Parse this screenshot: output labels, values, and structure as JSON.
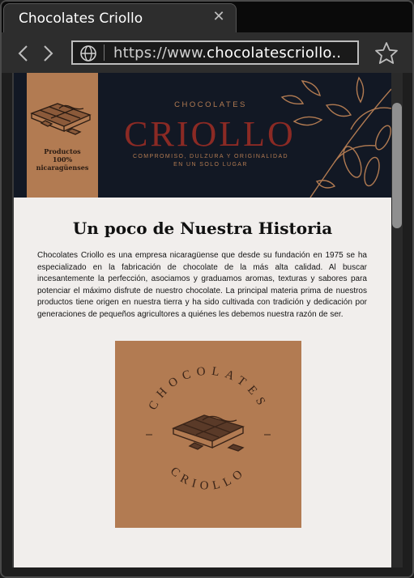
{
  "browser": {
    "tab_title": "Chocolates Criollo",
    "tab_close_icon": "close-icon",
    "url_scheme": "https://www.",
    "url_host": "chocolatescriollo..",
    "back_icon": "chevron-left-icon",
    "forward_icon": "chevron-right-icon",
    "site_icon": "globe-icon",
    "bookmark_icon": "star-icon"
  },
  "banner": {
    "left_label_line1": "Productos",
    "left_label_line2": "100% nicaragüenses",
    "small_heading": "CHOCOLATES",
    "brand_title": "CRIOLLO",
    "tagline_line1": "COMPROMISO, DULZURA Y ORIGINALIDAD",
    "tagline_line2": "EN UN SOLO LUGAR",
    "colors": {
      "background": "#121824",
      "accent": "#b27b52",
      "title": "#8b2a24"
    }
  },
  "story": {
    "heading": "Un poco de Nuestra Historia",
    "body": "Chocolates Criollo es una empresa nicaragüense que desde su fundación en 1975 se ha especializado en la fabricación de chocolate de la más alta calidad. Al buscar incesantemente la perfección, asociamos y graduamos aromas, texturas y sabores para potenciar el máximo disfrute de nuestro chocolate. La principal materia prima de nuestros productos tiene origen en nuestra tierra y ha sido cultivada con tradición y dedicación por generaciones de pequeños agricultores a quiénes les debemos nuestra razón de ser."
  },
  "logo": {
    "top_arc": "CHOCOLATES",
    "bottom_arc": "CRIOLLO",
    "colors": {
      "background": "#b27b52",
      "ink": "#3a2418"
    }
  }
}
